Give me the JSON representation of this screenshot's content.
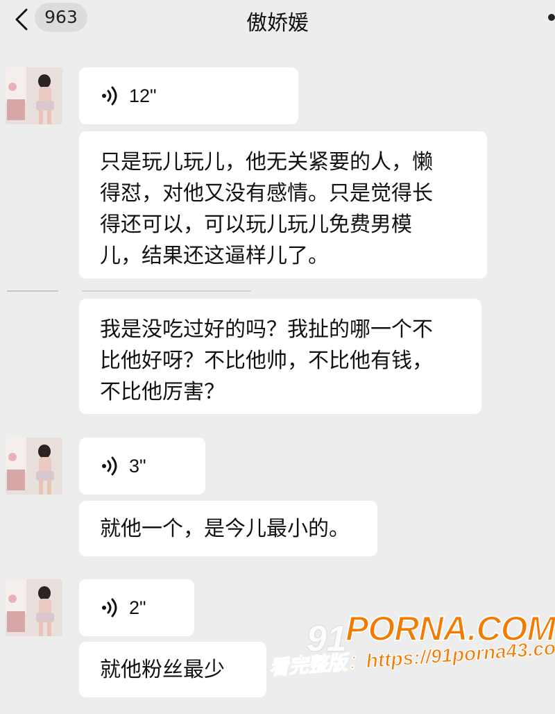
{
  "header": {
    "unread_count": "963",
    "title": "傲娇媛"
  },
  "messages": [
    {
      "type": "voice",
      "duration": "12\""
    },
    {
      "type": "text",
      "lines": [
        "只是玩儿玩儿，他无关紧要的人，懒",
        "得怼，对他又没有感情。只是觉得长",
        "得还可以，可以玩儿玩儿免费男模",
        "儿，结果还这逼样儿了。"
      ]
    },
    {
      "type": "text",
      "lines": [
        "我是没吃过好的吗？我扯的哪一个不",
        "比他好呀？不比他帅，不比他有钱，",
        "不比他厉害？"
      ]
    },
    {
      "type": "voice",
      "duration": "3\""
    },
    {
      "type": "text",
      "lines": [
        "就他一个，是今儿最小的。"
      ]
    },
    {
      "type": "voice",
      "duration": "2\""
    },
    {
      "type": "text",
      "lines": [
        "就他粉丝最少"
      ]
    }
  ],
  "watermark": {
    "prefix": "91",
    "brand": "PORNA.COM",
    "url": "看完整版：https://91porna43.com"
  },
  "colors": {
    "background": "#ededed",
    "bubble": "#ffffff",
    "watermark": "#f57a00"
  },
  "icons": [
    "back-chevron-icon",
    "more-icon",
    "voice-wave-icon"
  ]
}
